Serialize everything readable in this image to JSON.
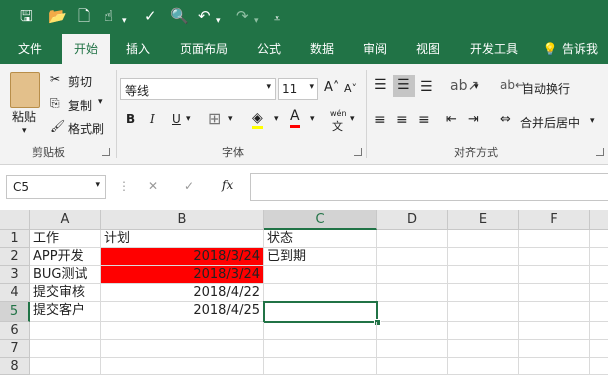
{
  "qat": {
    "icons": [
      "save-icon",
      "open-icon",
      "new-file-icon",
      "touch-mode-icon",
      "spelling-icon",
      "print-preview-icon",
      "undo-icon",
      "redo-icon",
      "customize-icon"
    ]
  },
  "tabs": [
    {
      "label": "文件"
    },
    {
      "label": "开始"
    },
    {
      "label": "插入"
    },
    {
      "label": "页面布局"
    },
    {
      "label": "公式"
    },
    {
      "label": "数据"
    },
    {
      "label": "审阅"
    },
    {
      "label": "视图"
    },
    {
      "label": "开发工具"
    }
  ],
  "tell_me": "告诉我",
  "clipboard": {
    "paste": "粘贴",
    "cut": "剪切",
    "copy": "复制",
    "format_painter": "格式刷",
    "group_label": "剪贴板"
  },
  "font": {
    "name": "等线",
    "size": "11",
    "bold": "B",
    "italic": "I",
    "underline": "U",
    "group_label": "字体",
    "wen": "wén"
  },
  "alignment": {
    "wrap_text": "自动换行",
    "merge_center": "合并后居中",
    "group_label": "对齐方式"
  },
  "formula_bar": {
    "name_box": "C5",
    "fx": "fx",
    "content": ""
  },
  "columns": [
    "A",
    "B",
    "C",
    "D",
    "E",
    "F"
  ],
  "rows": [
    {
      "num": "1",
      "cells": [
        "工作",
        "计划",
        "状态"
      ]
    },
    {
      "num": "2",
      "cells": [
        "APP开发",
        "2018/3/24",
        "已到期"
      ]
    },
    {
      "num": "3",
      "cells": [
        "BUG测试",
        "2018/3/24",
        ""
      ]
    },
    {
      "num": "4",
      "cells": [
        "提交审核",
        "2018/4/22",
        ""
      ]
    },
    {
      "num": "5",
      "cells": [
        "提交客户",
        "2018/4/25",
        ""
      ]
    },
    {
      "num": "6",
      "cells": [
        "",
        "",
        ""
      ]
    },
    {
      "num": "7",
      "cells": [
        "",
        "",
        ""
      ]
    },
    {
      "num": "8",
      "cells": [
        "",
        "",
        ""
      ]
    }
  ],
  "colors": {
    "accent": "#217346",
    "highlight": "#ff0000"
  }
}
